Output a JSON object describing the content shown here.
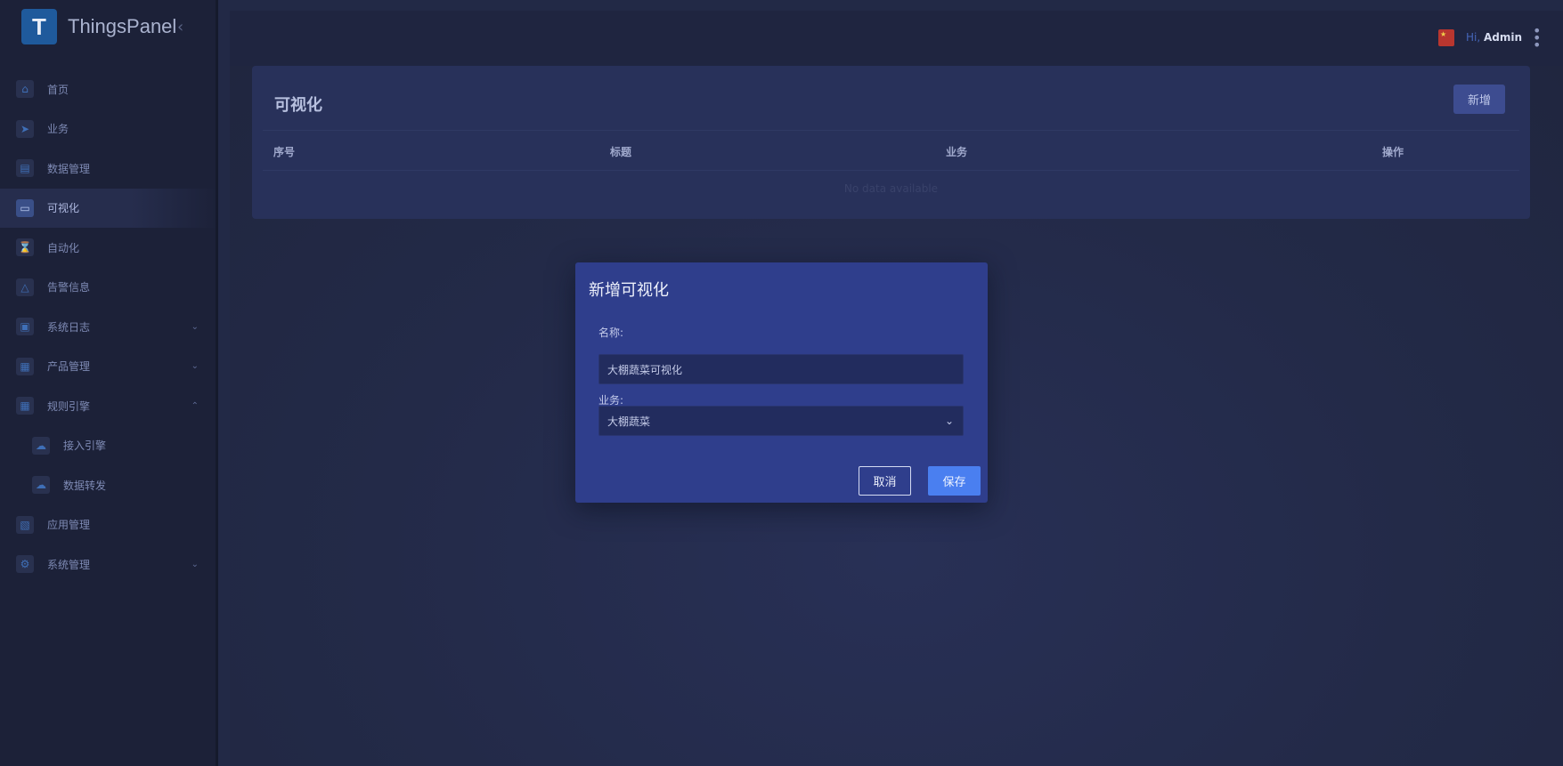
{
  "app": {
    "logo_text": "ThingsPanel",
    "logo_letter": "T"
  },
  "sidebar": {
    "items": [
      {
        "label": "首页",
        "icon": "home-icon"
      },
      {
        "label": "业务",
        "icon": "rocket-icon"
      },
      {
        "label": "数据管理",
        "icon": "clipboard-icon"
      },
      {
        "label": "可视化",
        "icon": "chart-monitor-icon",
        "active": true
      },
      {
        "label": "自动化",
        "icon": "hourglass-icon"
      },
      {
        "label": "告警信息",
        "icon": "warning-icon"
      },
      {
        "label": "系统日志",
        "icon": "box-icon",
        "chevron": "down"
      },
      {
        "label": "产品管理",
        "icon": "gift-icon",
        "chevron": "down"
      },
      {
        "label": "规则引擎",
        "icon": "gift-icon",
        "chevron": "up"
      },
      {
        "label": "接入引擎",
        "icon": "cloud-icon",
        "sub": true
      },
      {
        "label": "数据转发",
        "icon": "cloud-icon",
        "sub": true
      },
      {
        "label": "应用管理",
        "icon": "basket-icon"
      },
      {
        "label": "系统管理",
        "icon": "gear-icon",
        "chevron": "down"
      }
    ]
  },
  "header": {
    "greeting": "Hi,",
    "user": "Admin"
  },
  "page": {
    "title": "可视化",
    "add_label": "新增",
    "columns": [
      "序号",
      "标题",
      "业务",
      "操作"
    ],
    "empty_text": "No data available"
  },
  "modal": {
    "title": "新增可视化",
    "name_label": "名称:",
    "name_value": "大棚蔬菜可视化",
    "business_label": "业务:",
    "business_value": "大棚蔬菜",
    "cancel_label": "取消",
    "save_label": "保存"
  },
  "colors": {
    "accent": "#4a7ff0",
    "modal_bg": "#2f3e8c",
    "sidebar_bg": "#1c2138",
    "card_bg": "#28315a"
  }
}
